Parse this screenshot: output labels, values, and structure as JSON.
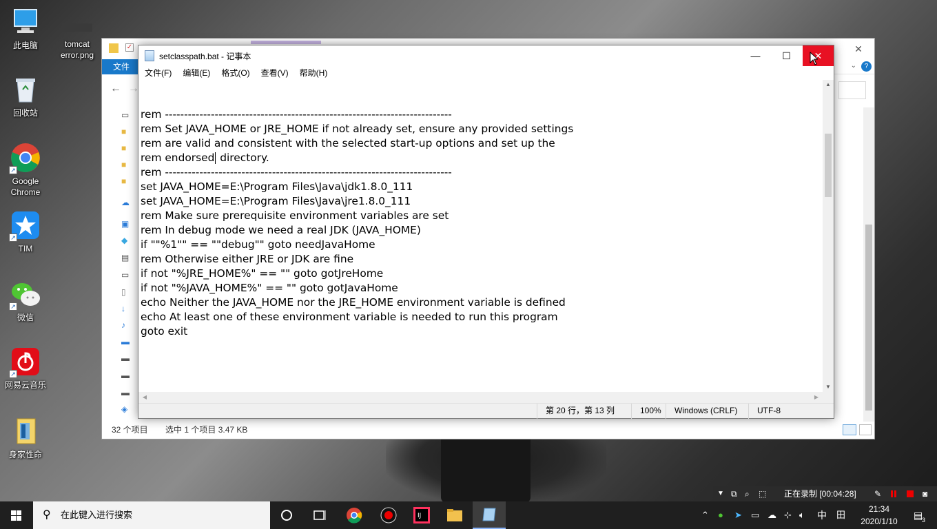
{
  "desktop": {
    "icons": [
      {
        "label": "此电脑",
        "icon": "computer-icon"
      },
      {
        "label": "tomcat\nerror.png",
        "icon": "image-file-icon"
      },
      {
        "label": "回收站",
        "icon": "recycle-bin-icon"
      },
      {
        "label": "Google\nChrome",
        "icon": "chrome-icon"
      },
      {
        "label": "TIM",
        "icon": "tim-icon"
      },
      {
        "label": "微信",
        "icon": "wechat-icon"
      },
      {
        "label": "网易云音乐",
        "icon": "netease-music-icon"
      },
      {
        "label": "身家性命",
        "icon": "folder-icon"
      }
    ]
  },
  "explorer": {
    "file_tab": "文件",
    "status_items": "32 个项目",
    "status_selected": "选中 1 个项目  3.47 KB"
  },
  "notepad": {
    "title": "setclasspath.bat - 记事本",
    "menu": [
      "文件(F)",
      "编辑(E)",
      "格式(O)",
      "查看(V)",
      "帮助(H)"
    ],
    "lines": [
      "rem ---------------------------------------------------------------------------",
      "rem Set JAVA_HOME or JRE_HOME if not already set, ensure any provided settings",
      "rem are valid and consistent with the selected start-up options and set up the",
      "rem endorsed",
      "rem ---------------------------------------------------------------------------",
      "",
      "set JAVA_HOME=E:\\Program Files\\Java\\jdk1.8.0_111",
      "set JAVA_HOME=E:\\Program Files\\Java\\jre1.8.0_111",
      "",
      "rem Make sure prerequisite environment variables are set",
      "",
      "rem In debug mode we need a real JDK (JAVA_HOME)",
      "if \"\"%1\"\" == \"\"debug\"\" goto needJavaHome",
      "",
      "rem Otherwise either JRE or JDK are fine",
      "if not \"%JRE_HOME%\" == \"\" goto gotJreHome",
      "if not \"%JAVA_HOME%\" == \"\" goto gotJavaHome",
      "echo Neither the JAVA_HOME nor the JRE_HOME environment variable is defined",
      "echo At least one of these environment variable is needed to run this program",
      "goto exit"
    ],
    "line4_after_cursor": " directory.",
    "status": {
      "position": "第 20 行，第 13 列",
      "zoom": "100%",
      "line_ending": "Windows (CRLF)",
      "encoding": "UTF-8"
    }
  },
  "taskbar": {
    "search_placeholder": "在此键入进行搜索",
    "apps": [
      "cortana-icon",
      "task-view-icon",
      "chrome-icon",
      "recorder-icon",
      "intellij-icon",
      "explorer-icon",
      "notepad-icon"
    ],
    "ime": "中",
    "time": "21:34",
    "date": "2020/1/10",
    "notifications": "3"
  },
  "recorder": {
    "status": "正在录制 [00:04:28]"
  },
  "colors": {
    "close_red": "#e81123",
    "file_tab_blue": "#1979ca",
    "taskbar": "#1f1f1f"
  }
}
